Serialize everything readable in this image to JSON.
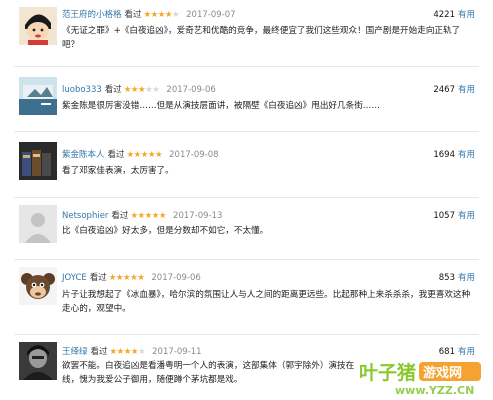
{
  "reviews": [
    {
      "user": "范王府的小格格",
      "watched": "看过",
      "rating": 4,
      "date": "2017-09-07",
      "votes": "4221",
      "useful_label": "有用",
      "text": "《无证之罪》+《白夜追凶》，爱奇艺和优酷的竞争，最终便宜了我们这些观众！国产剧是开始走向正轨了吧？"
    },
    {
      "user": "luobo333",
      "watched": "看过",
      "rating": 3,
      "date": "2017-09-06",
      "votes": "2467",
      "useful_label": "有用",
      "text": "紫金陈是很厉害没错……但是从演技层面讲，被隔壁《白夜追凶》甩出好几条街……"
    },
    {
      "user": "紫金陈本人",
      "watched": "看过",
      "rating": 5,
      "date": "2017-09-08",
      "votes": "1694",
      "useful_label": "有用",
      "text": "看了邓家佳表演，太厉害了。"
    },
    {
      "user": "Netsophier",
      "watched": "看过",
      "rating": 5,
      "date": "2017-09-13",
      "votes": "1057",
      "useful_label": "有用",
      "text": "比《白夜追凶》好太多，但是分数却不如它，不太懂。"
    },
    {
      "user": "JOYCE",
      "watched": "看过",
      "rating": 5,
      "date": "2017-09-06",
      "votes": "853",
      "useful_label": "有用",
      "text": "片子让我想起了《冰血暴》，哈尔滨的氛围让人与人之间的距离更远些。比起那种上来杀杀杀，我更喜欢这种走心的，观望中。"
    },
    {
      "user": "王绎绿",
      "watched": "看过",
      "rating": 4,
      "date": "2017-09-11",
      "votes": "681",
      "useful_label": "有用",
      "text": "欲罢不能。白夜追凶是看潘粤明一个人的表演，这部集体（郭宇除外）演技在线，愧为我爱公子御用，随便蹲个茅坑都是戏。"
    }
  ],
  "watermark": {
    "brand": "叶子猪",
    "brand2": "游戏网",
    "url": "www.YZZ.CN",
    "colors": {
      "green": "#7fc41c",
      "orange": "#f39a1e"
    }
  },
  "colors": {
    "link": "#3377aa",
    "star": "#f6a623",
    "date": "#8a8a8a"
  }
}
